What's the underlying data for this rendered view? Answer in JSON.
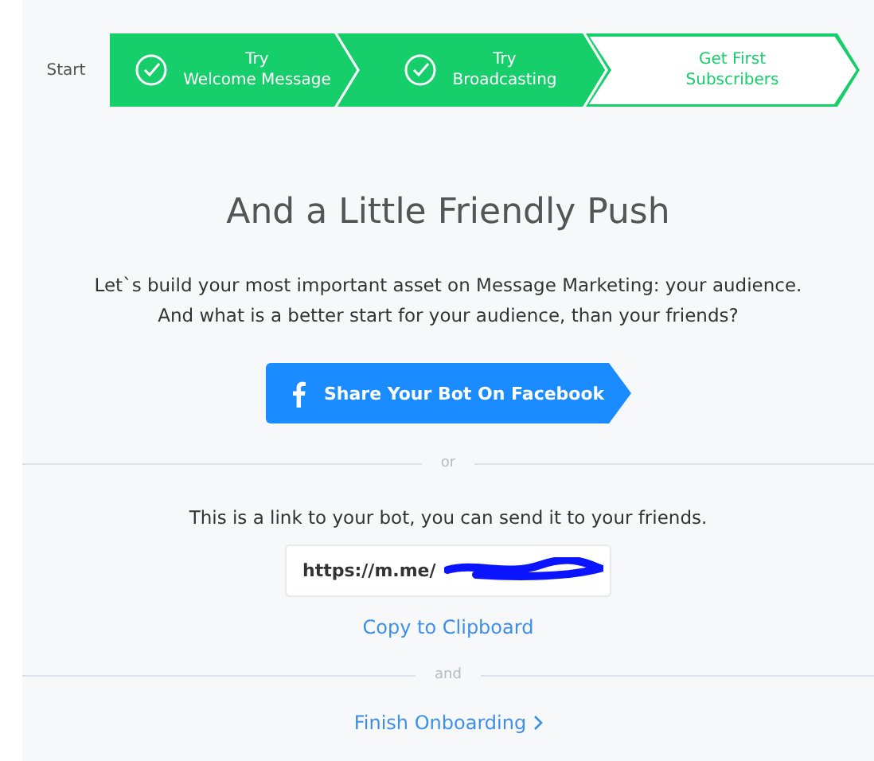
{
  "stepper": {
    "start_label": "Start",
    "steps": [
      {
        "label": "Try\nWelcome Message",
        "done": true
      },
      {
        "label": "Try\nBroadcasting",
        "done": true
      },
      {
        "label": "Get First\nSubscribers",
        "done": false
      }
    ]
  },
  "heading": "And a Little Friendly Push",
  "intro": [
    "Let`s build your most important asset on Message Marketing: your audience.",
    "And what is a better start for your audience, than your friends?"
  ],
  "share_button": "Share Your Bot On Facebook",
  "divider_1": "or",
  "link_text": "This is a link to your bot, you can send it to your friends.",
  "link_field": {
    "value": "https://m.me/",
    "redacted": true
  },
  "copy_link": "Copy to Clipboard",
  "divider_2": "and",
  "finish_link": "Finish Onboarding"
}
